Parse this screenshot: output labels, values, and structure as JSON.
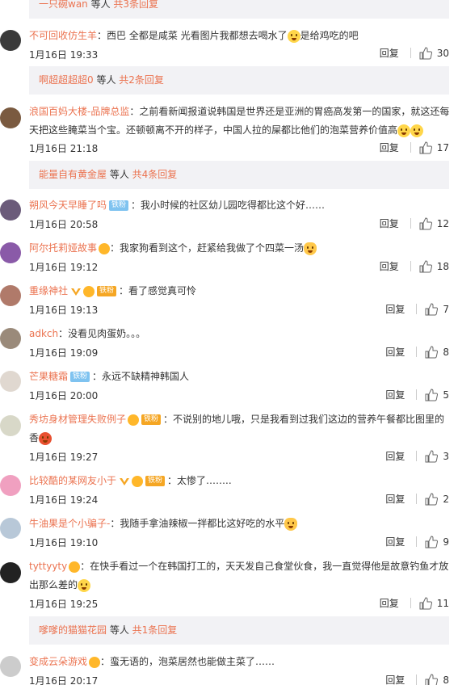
{
  "reply_bars": [
    {
      "user": "一只碗wan",
      "mid": " 等人 ",
      "count": "共3条回复"
    },
    {
      "user": "啊超超超超0",
      "mid": " 等人 ",
      "count": "共2条回复"
    },
    {
      "user": "能量自有黄金屋",
      "mid": " 等人 ",
      "count": "共4条回复"
    },
    {
      "user": "嗲嗲的猫猫花园",
      "mid": " 等人 ",
      "count": "共1条回复"
    }
  ],
  "comments": [
    {
      "name": "不可回收仿生羊",
      "text": "：西巴 全都是咸菜 光看图片我都想去喝水了",
      "text2": "是给鸡吃的吧",
      "time": "1月16日 19:33",
      "likes": "30"
    },
    {
      "name": "浪国百妈大楼-品牌总监",
      "text": "：之前看新闻报道说韩国是世界还是亚洲的胃癌高发第一的国家，就这还每天把这些腌菜当个宝。还顿顿离不开的样子，中国人拉的屎都比他们的泡菜营养价值高",
      "time": "1月16日 21:18",
      "likes": "17"
    },
    {
      "name": "朔风今天早睡了吗",
      "badge": "铁粉",
      "text": "：我小时候的社区幼儿园吃得都比这个好……",
      "time": "1月16日 20:58",
      "likes": "12"
    },
    {
      "name": "阿尔托莉娅故事",
      "text": "：我家狗看到这个，赶紧给我做了个四菜一汤",
      "time": "1月16日 19:12",
      "likes": "18"
    },
    {
      "name": "重缘神社",
      "badge": "铁粉",
      "text": "：看了感觉真可怜",
      "time": "1月16日 19:13",
      "likes": "7"
    },
    {
      "name": "adkch",
      "text": "：没看见肉蛋奶。。。",
      "time": "1月16日 19:09",
      "likes": "8"
    },
    {
      "name": "芒果糖霜",
      "badge": "铁粉",
      "text": "：永远不缺精神韩国人",
      "time": "1月16日 20:00",
      "likes": "5"
    },
    {
      "name": "秀坊身材管理失败例子",
      "badge": "铁粉",
      "text": "：不说别的地儿哦，只是我看到过我们这边的营养午餐都比图里的香",
      "time": "1月16日 19:27",
      "likes": "3"
    },
    {
      "name": "比较酷的某网友小于",
      "badge": "铁粉",
      "text": "：太惨了……..",
      "time": "1月16日 19:24",
      "likes": "2"
    },
    {
      "name": "牛油果是个小骗子-",
      "text": "：我随手拿油辣椒一拌都比这好吃的水平",
      "time": "1月16日 19:10",
      "likes": "9"
    },
    {
      "name": "tyttyyty",
      "text": "：在快手看过一个在韩国打工的，天天发自己食堂伙食，我一直觉得他是故意钓鱼才放出那么差的",
      "time": "1月16日 19:25",
      "likes": "11"
    },
    {
      "name": "变成云朵游戏",
      "text": "：蛮无语的，泡菜居然也能做主菜了……",
      "time": "1月16日 20:17",
      "likes": "8"
    }
  ],
  "reply_label": "回复",
  "colors": {
    "accent": "#eb7350",
    "text": "#333333",
    "bar": "#f2f2f5"
  }
}
